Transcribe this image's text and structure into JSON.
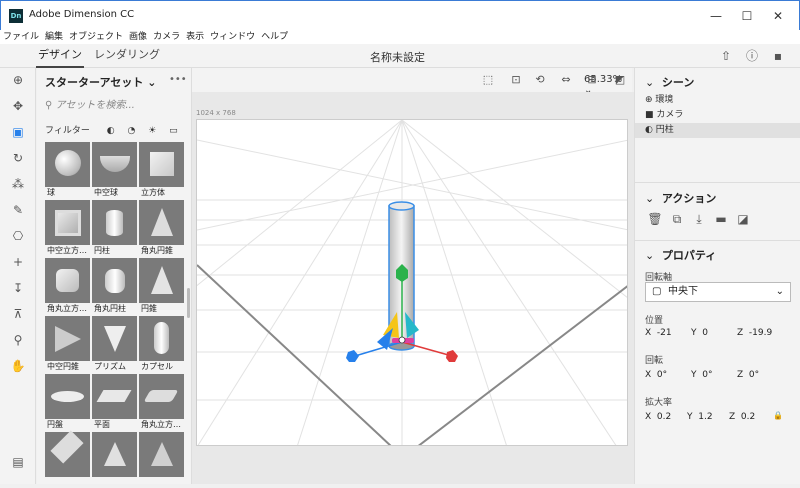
{
  "window": {
    "title": "Adobe Dimension CC",
    "logo": "Dn",
    "min": "—",
    "max": "☐",
    "close": "✕"
  },
  "menu": [
    "ファイル",
    "編集",
    "オブジェクト",
    "画像",
    "カメラ",
    "表示",
    "ウィンドウ",
    "ヘルプ"
  ],
  "tabs": {
    "design": "デザイン",
    "render": "レンダリング"
  },
  "document_title": "名称未設定",
  "assets": {
    "title": "スターターアセット",
    "search_placeholder": "アセットを検索...",
    "filter_label": "フィルター",
    "more": "•••",
    "items": [
      "球",
      "中空球",
      "立方体",
      "中空立方…",
      "円柱",
      "角丸円錐",
      "角丸立方…",
      "角丸円柱",
      "円錐",
      "中空円錐",
      "プリズム",
      "カプセル",
      "円盤",
      "平面",
      "角丸立方…",
      "",
      "",
      ""
    ]
  },
  "viewport": {
    "zoom": "65.33%",
    "size": "1024 x 768"
  },
  "scene": {
    "title": "シーン",
    "items": [
      "環境",
      "カメラ",
      "円柱"
    ],
    "selected": 2
  },
  "actions": {
    "title": "アクション"
  },
  "properties": {
    "title": "プロパティ",
    "pivot_label": "回転軸",
    "pivot_value": "中央下",
    "position_label": "位置",
    "pos_x": "-21",
    "pos_y": "0",
    "pos_z": "-19.9",
    "rotation_label": "回転",
    "rot_x": "0°",
    "rot_y": "0°",
    "rot_z": "0°",
    "scale_label": "拡大率",
    "scl_x": "0.2",
    "scl_y": "1.2",
    "scl_z": "0.2",
    "x": "X",
    "y": "Y",
    "z": "Z"
  }
}
